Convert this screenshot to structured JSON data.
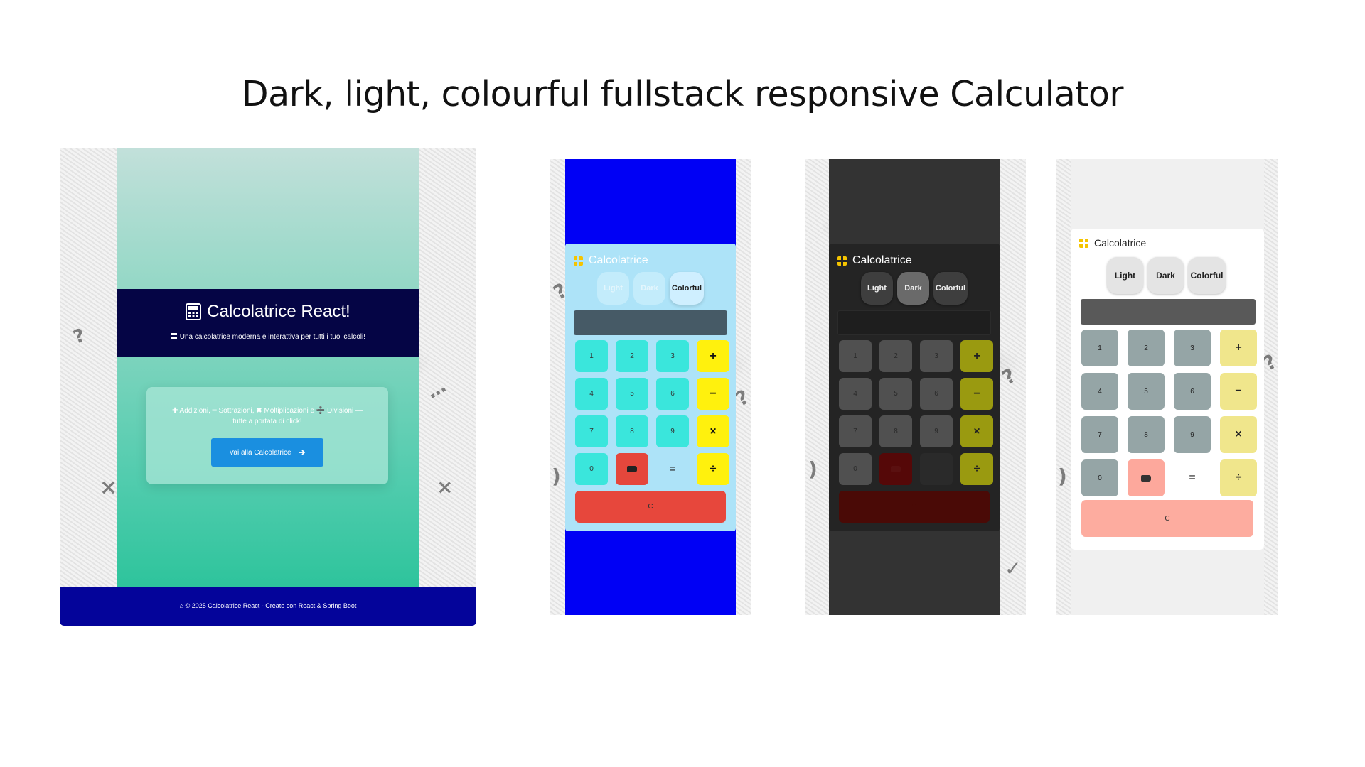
{
  "headline": "Dark, light, colourful fullstack responsive Calculator",
  "landing": {
    "title": "Calcolatrice React!",
    "subtitle": "Una calcolatrice moderna e interattiva per tutti i tuoi calcoli!",
    "subtitle_icon": "equals-icon",
    "card_line1": "✚ Addizioni, ━ Sottrazioni, ✖ Moltiplicazioni e ➗ Divisioni —",
    "card_line2": "tutte a portata di click!",
    "button_label": "Vai alla Calcolatrice",
    "button_icon": "arrow-right-icon",
    "footer": "© 2025 Calcolatrice React - Creato con React & Spring Boot",
    "footer_icon": "home-icon",
    "colors": {
      "hero": "#050545",
      "footer": "#04049a",
      "button": "#1a8fe0",
      "gradient_end": "#2ec49c"
    }
  },
  "calculator": {
    "title": "Calcolatrice",
    "themes": [
      "Light",
      "Dark",
      "Colorful"
    ],
    "keys": [
      {
        "label": "1",
        "kind": "num"
      },
      {
        "label": "2",
        "kind": "num"
      },
      {
        "label": "3",
        "kind": "num"
      },
      {
        "label": "+",
        "kind": "op"
      },
      {
        "label": "4",
        "kind": "num"
      },
      {
        "label": "5",
        "kind": "num"
      },
      {
        "label": "6",
        "kind": "num"
      },
      {
        "label": "−",
        "kind": "op"
      },
      {
        "label": "7",
        "kind": "num"
      },
      {
        "label": "8",
        "kind": "num"
      },
      {
        "label": "9",
        "kind": "num"
      },
      {
        "label": "×",
        "kind": "op"
      },
      {
        "label": "0",
        "kind": "num"
      },
      {
        "label": "",
        "kind": "back",
        "icon": "backspace-icon"
      },
      {
        "label": "=",
        "kind": "eq"
      },
      {
        "label": "÷",
        "kind": "op"
      }
    ],
    "clear_label": "C",
    "display_value": ""
  },
  "variants": [
    {
      "id": "colorful",
      "active_theme": "Colorful",
      "colors": {
        "strip": "#0000f5",
        "body": "#ade3f8",
        "num": "#3ae6dc",
        "op": "#fff10d",
        "clear": "#e7473c"
      }
    },
    {
      "id": "dark",
      "active_theme": "Dark",
      "colors": {
        "strip": "#333333",
        "body": "#242424",
        "num": "#505050",
        "op": "#9a9a10",
        "clear": "#4a0a06"
      }
    },
    {
      "id": "light",
      "active_theme": "Light",
      "colors": {
        "strip": "#f0f0f0",
        "body": "#ffffff",
        "num": "#95a5a6",
        "op": "#f0e68c",
        "clear": "#fdac9f"
      }
    }
  ]
}
